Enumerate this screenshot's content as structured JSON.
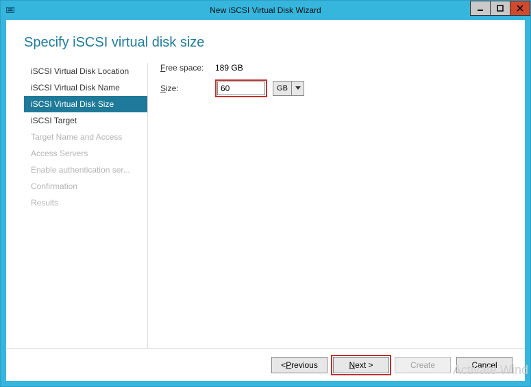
{
  "window": {
    "title": "New iSCSI Virtual Disk Wizard"
  },
  "page": {
    "heading": "Specify iSCSI virtual disk size"
  },
  "sidebar": {
    "steps": [
      {
        "label": "iSCSI Virtual Disk Location",
        "state": "done"
      },
      {
        "label": "iSCSI Virtual Disk Name",
        "state": "done"
      },
      {
        "label": "iSCSI Virtual Disk Size",
        "state": "active"
      },
      {
        "label": "iSCSI Target",
        "state": "pending"
      },
      {
        "label": "Target Name and Access",
        "state": "disabled"
      },
      {
        "label": "Access Servers",
        "state": "disabled"
      },
      {
        "label": "Enable authentication ser...",
        "state": "disabled"
      },
      {
        "label": "Confirmation",
        "state": "disabled"
      },
      {
        "label": "Results",
        "state": "disabled"
      }
    ]
  },
  "form": {
    "free_space_label_pre": "F",
    "free_space_label_post": "ree space:",
    "free_space_value": "189 GB",
    "size_label_pre": "S",
    "size_label_post": "ize:",
    "size_value": "60",
    "unit_selected": "GB"
  },
  "footer": {
    "previous_pre": "< ",
    "previous_u": "P",
    "previous_post": "revious",
    "next_u": "N",
    "next_post": "ext >",
    "create": "Create",
    "cancel": "Cancel"
  },
  "watermark": "Activate Wind"
}
